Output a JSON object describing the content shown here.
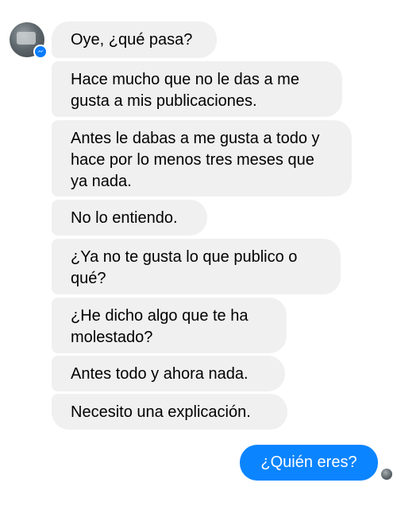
{
  "contact": {
    "avatar_icon": "profile-photo",
    "badge_icon": "messenger-icon",
    "badge_color": "#0a7cff"
  },
  "incoming_messages": [
    "Oye, ¿qué pasa?",
    "Hace mucho que no le das a me gusta a mis publicaciones.",
    "Antes le dabas a me gusta a todo y hace por lo menos tres meses que ya nada.",
    "No lo entiendo.",
    "¿Ya no te gusta lo que publico o qué?",
    "¿He dicho algo que te ha molestado?",
    "Antes todo y ahora nada.",
    "Necesito una explicación."
  ],
  "outgoing_messages": [
    "¿Quién eres?"
  ],
  "colors": {
    "incoming_bubble": "#f0f0f0",
    "outgoing_bubble": "#0b84ff",
    "outgoing_text": "#ffffff"
  }
}
